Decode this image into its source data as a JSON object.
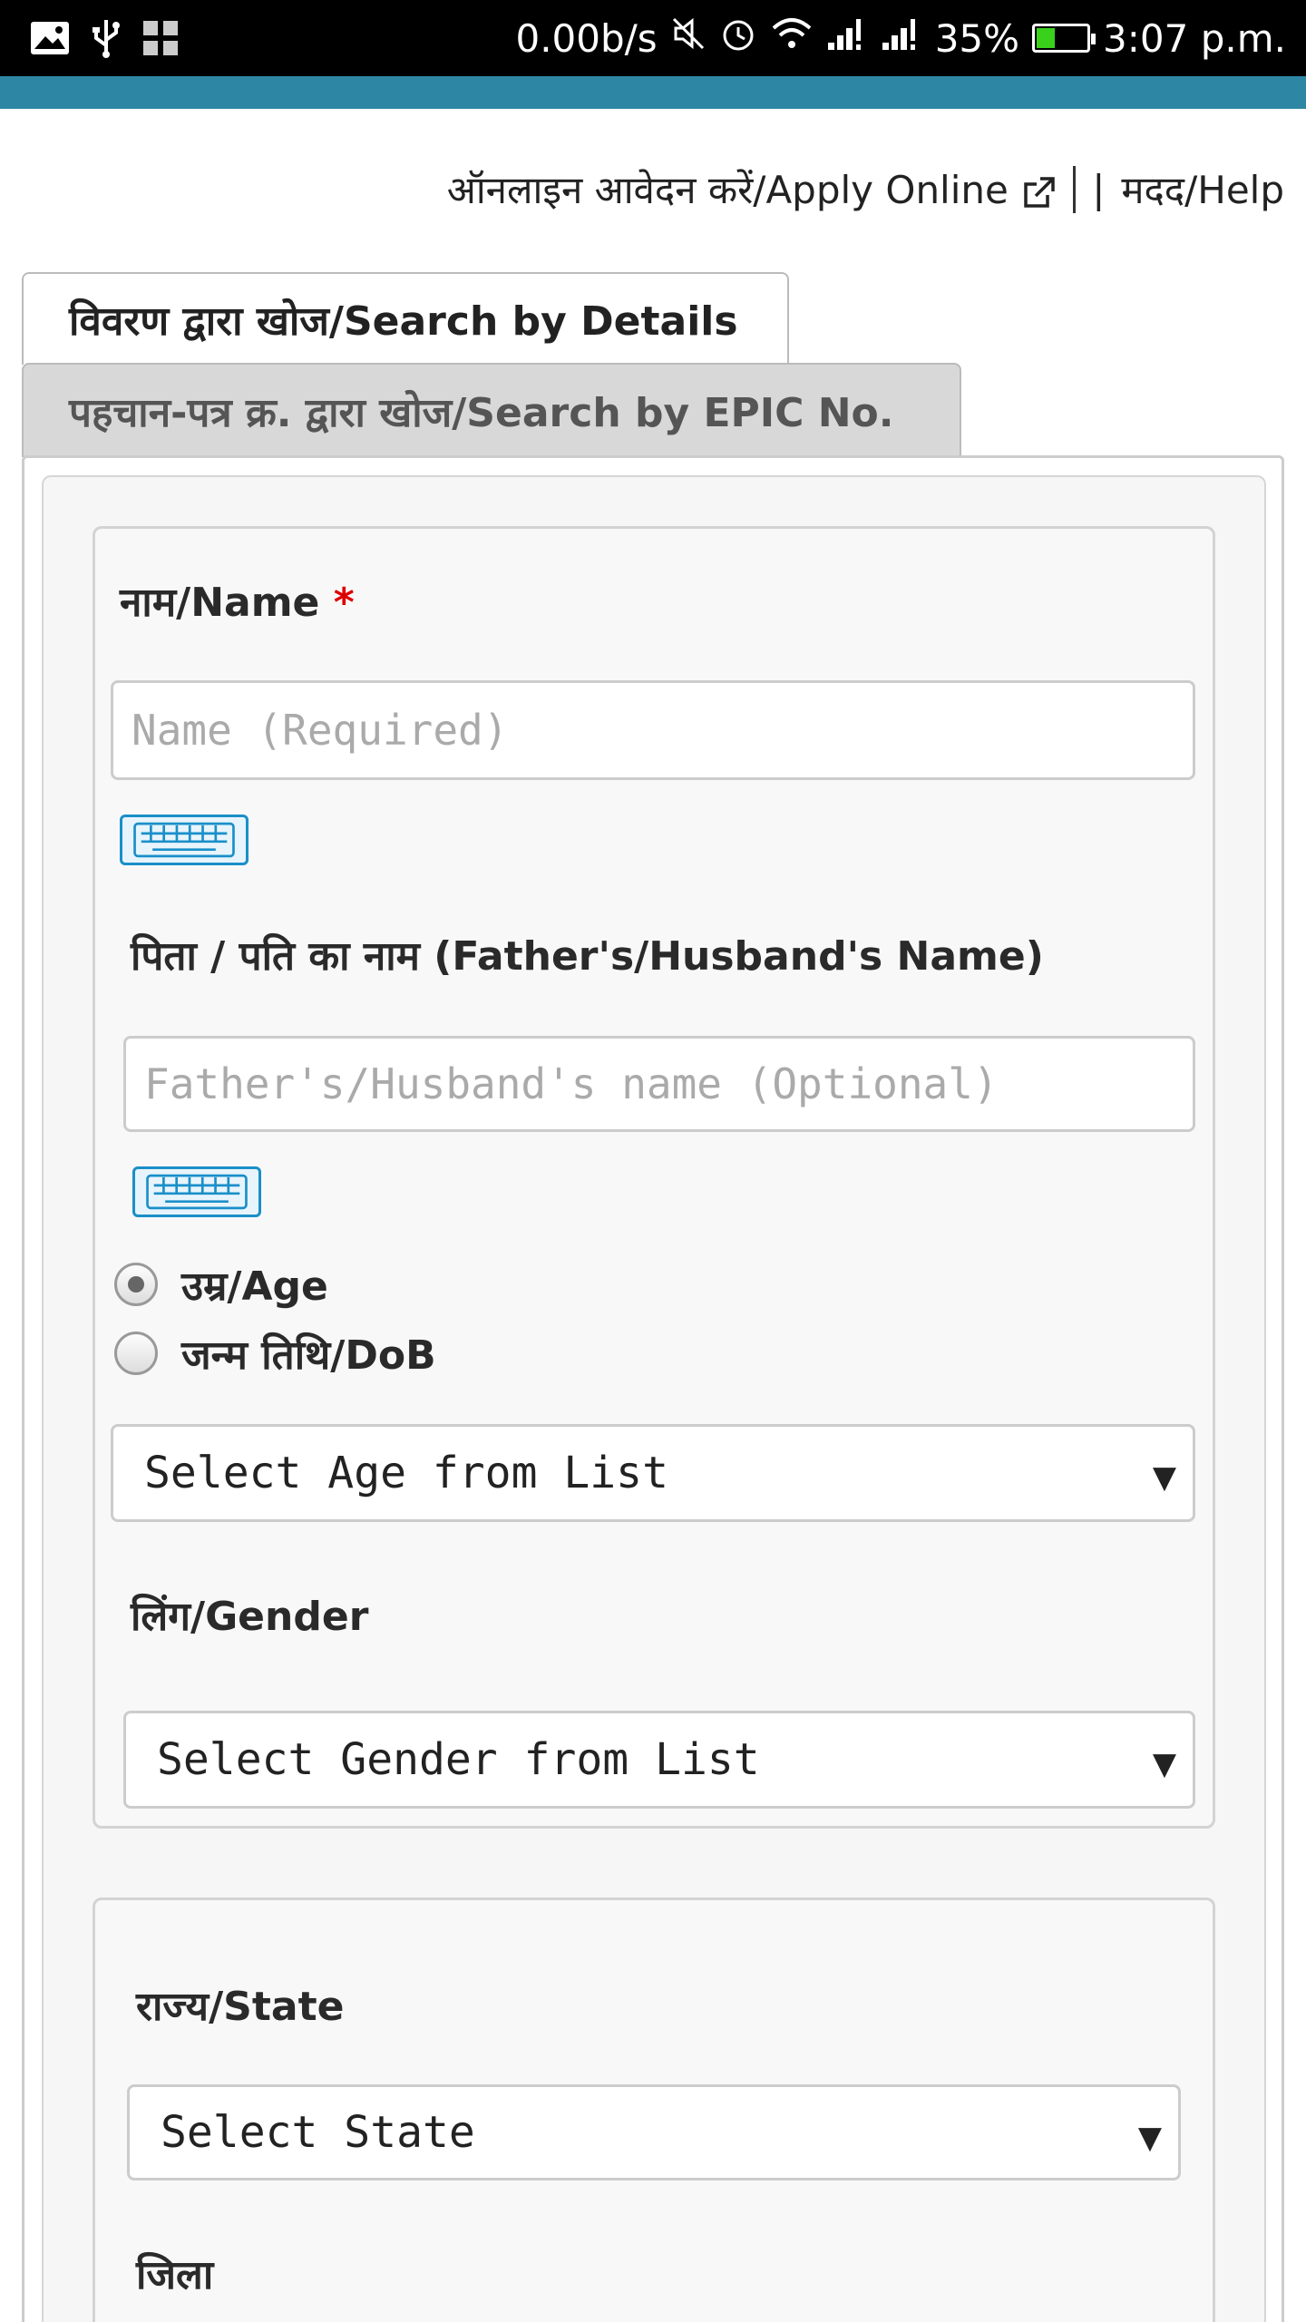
{
  "status_bar": {
    "network_speed": "0.00b/s",
    "battery_percent": "35%",
    "battery_level": 0.35,
    "time": "3:07 p.m."
  },
  "top_links": {
    "apply_online": "ऑनलाइन आवेदन करें/Apply Online",
    "help": "मदद/Help",
    "divider": "|"
  },
  "tabs": [
    {
      "label": "विवरण द्वारा खोज/Search by Details",
      "active": true
    },
    {
      "label": "पहचान-पत्र क्र. द्वारा खोज/Search by EPIC No.",
      "active": false
    }
  ],
  "form": {
    "name_label": "नाम/Name",
    "required_mark": "*",
    "name_placeholder": "Name (Required)",
    "father_label": "पिता / पति का नाम (Father's/Husband's Name)",
    "father_placeholder": "Father's/Husband's name (Optional)",
    "age_option": "उम्र/Age",
    "dob_option": "जन्म तिथि/DoB",
    "age_select": "Select Age from List",
    "gender_label": "लिंग/Gender",
    "gender_select": "Select Gender from List",
    "state_label": "राज्य/State",
    "state_select": "Select State",
    "district_label": "जिला"
  },
  "colors": {
    "accent_bar": "#2d87a4",
    "keyboard_icon": "#1a8fc9",
    "required": "#dd0000",
    "battery_fill": "#39d11c"
  }
}
